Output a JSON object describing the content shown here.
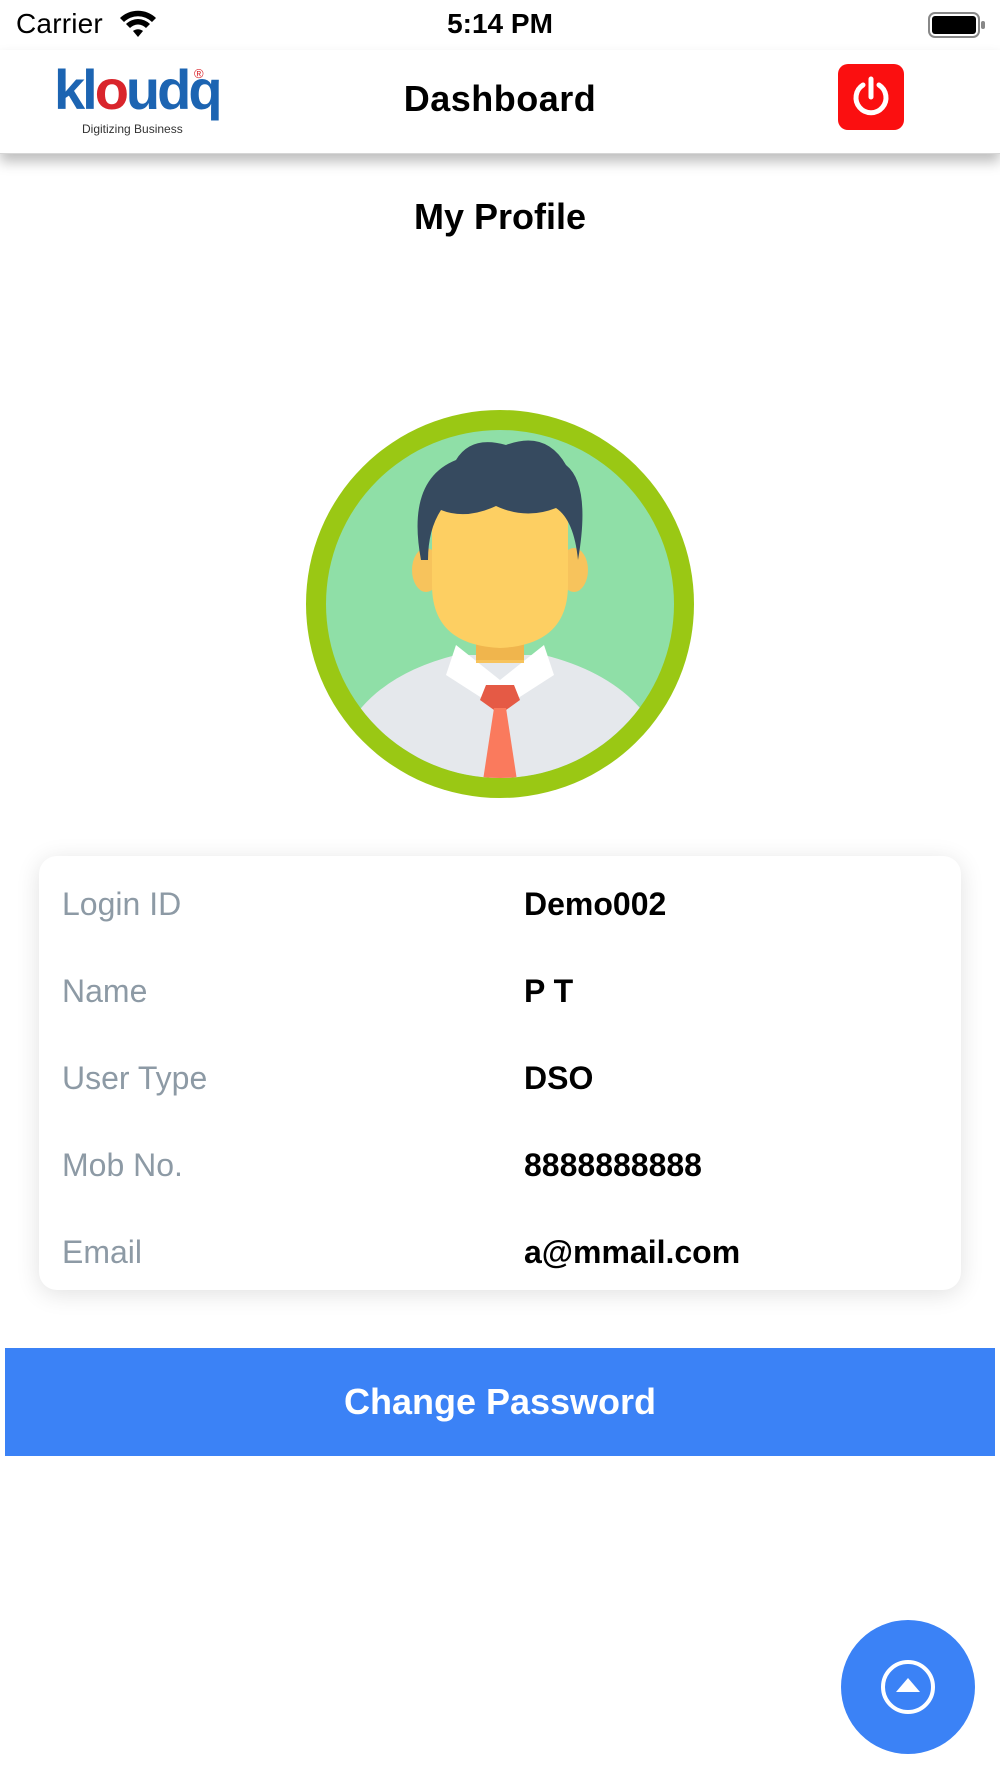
{
  "status_bar": {
    "carrier": "Carrier",
    "time": "5:14 PM",
    "icons": [
      "wifi-icon",
      "battery-icon"
    ]
  },
  "navbar": {
    "logo_text_k": "kl",
    "logo_text_o": "o",
    "logo_text_rest": "udq",
    "logo_registered": "®",
    "logo_tagline": "Digitizing Business",
    "title": "Dashboard",
    "power_icon": "power-icon",
    "power_color": "#fb0f10"
  },
  "profile": {
    "heading": "My Profile",
    "avatar_icon": "user-avatar-icon"
  },
  "details": [
    {
      "label": "Login ID",
      "value": "Demo002"
    },
    {
      "label": "Name",
      "value": "P T"
    },
    {
      "label": "User Type",
      "value": "DSO"
    },
    {
      "label": "Mob No.",
      "value": "8888888888"
    },
    {
      "label": "Email",
      "value": "a@mmail.com"
    }
  ],
  "actions": {
    "change_password": "Change Password",
    "fab_icon": "chevron-up-circle-icon"
  },
  "colors": {
    "accent": "#3b82f6",
    "label_gray": "#8d9aa5",
    "avatar_ring": "#9ac814",
    "avatar_bg": "#8fdfa7"
  }
}
